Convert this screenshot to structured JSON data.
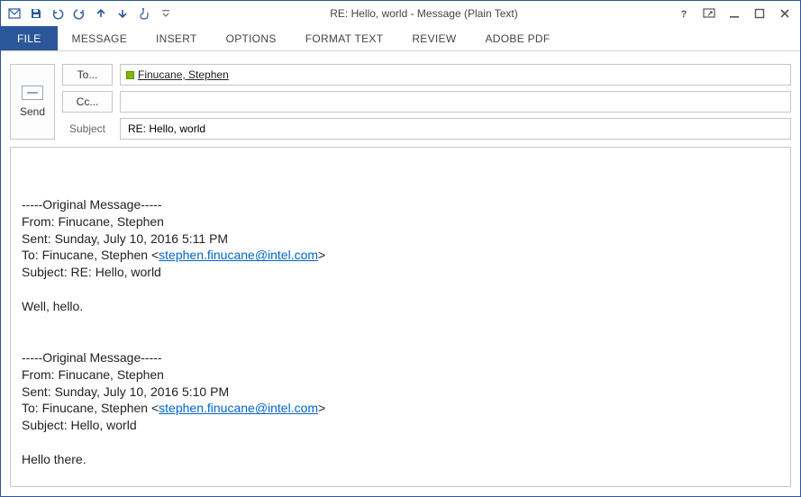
{
  "window": {
    "title": "RE: Hello, world - Message (Plain Text)"
  },
  "ribbon": {
    "tabs": {
      "file": "FILE",
      "message": "MESSAGE",
      "insert": "INSERT",
      "options": "OPTIONS",
      "format_text": "FORMAT TEXT",
      "review": "REVIEW",
      "adobe_pdf": "ADOBE PDF"
    }
  },
  "compose": {
    "send_label": "Send",
    "to_label": "To...",
    "cc_label": "Cc...",
    "subject_label": "Subject",
    "to_recipient": "Finucane, Stephen",
    "cc_value": "",
    "subject_value": "RE: Hello, world"
  },
  "body": {
    "blank1": "",
    "sep1": "-----Original Message-----",
    "from1": "From: Finucane, Stephen",
    "sent1": "Sent: Sunday, July 10, 2016 5:11 PM",
    "to1_prefix": "To: Finucane, Stephen <",
    "to1_email": "stephen.finucane@intel.com",
    "to1_suffix": ">",
    "subj1": "Subject: RE: Hello, world",
    "msg1": "Well, hello.",
    "sep2": "-----Original Message-----",
    "from2": "From: Finucane, Stephen",
    "sent2": "Sent: Sunday, July 10, 2016 5:10 PM",
    "to2_prefix": "To: Finucane, Stephen <",
    "to2_email": "stephen.finucane@intel.com",
    "to2_suffix": ">",
    "subj2": "Subject: Hello, world",
    "msg2": "Hello there."
  }
}
